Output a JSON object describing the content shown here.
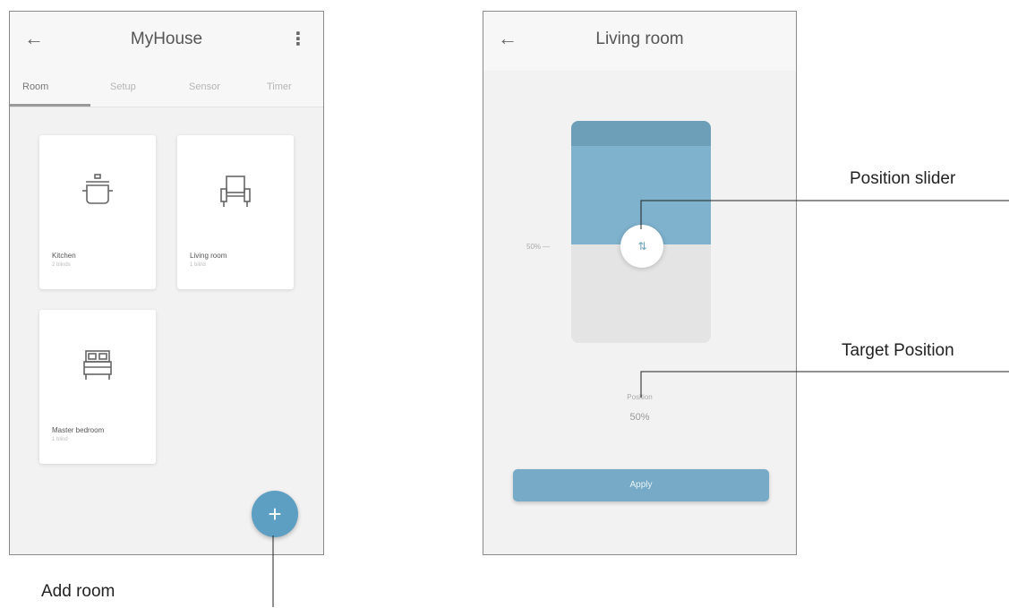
{
  "screen1": {
    "title": "MyHouse",
    "back_icon": "←",
    "menu_icon": "⋮",
    "tabs": [
      {
        "label": "Room",
        "active": true
      },
      {
        "label": "Setup",
        "active": false
      },
      {
        "label": "Sensor",
        "active": false
      },
      {
        "label": "Timer",
        "active": false
      }
    ],
    "rooms": [
      {
        "name": "Kitchen",
        "sub": "2 blinds",
        "icon": "pot-icon"
      },
      {
        "name": "Living room",
        "sub": "1 blind",
        "icon": "armchair-icon"
      },
      {
        "name": "Master bedroom",
        "sub": "1 blind",
        "icon": "bed-icon"
      }
    ],
    "fab_icon": "+"
  },
  "screen2": {
    "title": "Living room",
    "back_icon": "←",
    "position_label": "50% —",
    "knob_icon": "⇅",
    "target_label": "Position",
    "target_value": "50%",
    "fill_fraction": 0.5,
    "apply_label": "Apply"
  },
  "callouts": {
    "position_slider": "Position slider",
    "target_position": "Target Position",
    "add_room": "Add room"
  },
  "colors": {
    "accent": "#5d9fc2",
    "blind_fill": "#7fb2cd",
    "blind_header": "#6e9fb8"
  }
}
